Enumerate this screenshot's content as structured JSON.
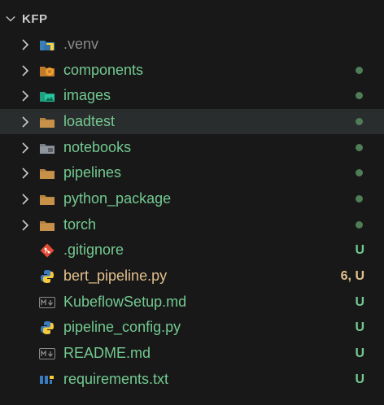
{
  "colors": {
    "background": "#181818",
    "selected_row": "#2a2d2e",
    "text_default": "#cccccc",
    "text_untracked": "#73c991",
    "text_dim": "#8a8a8a",
    "text_modified": "#e2c08d",
    "dot": "#4e7d56"
  },
  "root": {
    "label": "KFP"
  },
  "items": [
    {
      "label": ".venv",
      "kind": "folder",
      "icon": "python-folder-icon",
      "status": "",
      "dot": false,
      "color": "dim"
    },
    {
      "label": "components",
      "kind": "folder",
      "icon": "components-folder-icon",
      "status": "",
      "dot": true,
      "color": "untracked"
    },
    {
      "label": "images",
      "kind": "folder",
      "icon": "images-folder-icon",
      "status": "",
      "dot": true,
      "color": "untracked"
    },
    {
      "label": "loadtest",
      "kind": "folder",
      "icon": "folder-icon",
      "status": "",
      "dot": true,
      "color": "untracked",
      "selected": true
    },
    {
      "label": "notebooks",
      "kind": "folder",
      "icon": "notebooks-folder-icon",
      "status": "",
      "dot": true,
      "color": "untracked"
    },
    {
      "label": "pipelines",
      "kind": "folder",
      "icon": "folder-icon",
      "status": "",
      "dot": true,
      "color": "untracked"
    },
    {
      "label": "python_package",
      "kind": "folder",
      "icon": "folder-icon",
      "status": "",
      "dot": true,
      "color": "untracked"
    },
    {
      "label": "torch",
      "kind": "folder",
      "icon": "folder-icon",
      "status": "",
      "dot": true,
      "color": "untracked"
    },
    {
      "label": ".gitignore",
      "kind": "file",
      "icon": "git-icon",
      "status": "U",
      "dot": false,
      "color": "untracked"
    },
    {
      "label": "bert_pipeline.py",
      "kind": "file",
      "icon": "python-icon",
      "status": "6, U",
      "dot": false,
      "color": "modified"
    },
    {
      "label": "KubeflowSetup.md",
      "kind": "file",
      "icon": "markdown-icon",
      "status": "U",
      "dot": false,
      "color": "untracked"
    },
    {
      "label": "pipeline_config.py",
      "kind": "file",
      "icon": "python-icon",
      "status": "U",
      "dot": false,
      "color": "untracked"
    },
    {
      "label": "README.md",
      "kind": "file",
      "icon": "markdown-icon",
      "status": "U",
      "dot": false,
      "color": "untracked"
    },
    {
      "label": "requirements.txt",
      "kind": "file",
      "icon": "pip-requirements-icon",
      "status": "U",
      "dot": false,
      "color": "untracked"
    }
  ]
}
